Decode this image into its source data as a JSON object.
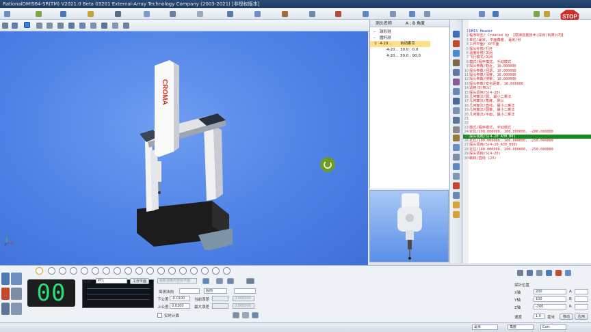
{
  "window": {
    "title": "RationalDMIS64-SR(TM) V2021.0 Beta 03201   External-Array Technology Company (2003-2021) [非授权版本]"
  },
  "probe_tree": {
    "header_col1": "测头名称",
    "header_col2": "A : B 角度",
    "items": [
      {
        "label": "球形测",
        "indent": 1
      },
      {
        "label": "圆杆测",
        "indent": 1
      },
      {
        "label": "4-20...",
        "value": "自动索引",
        "indent": 2,
        "selected": true
      },
      {
        "label": "4-20...",
        "value": "30.0 : 0.0",
        "indent": 3
      },
      {
        "label": "4-20...",
        "value": "30.0 : 90.0",
        "indent": 3
      }
    ]
  },
  "code_editor": {
    "lines": [
      {
        "n": "",
        "text": "DMIS  Header",
        "style": "blue"
      },
      {
        "n": "",
        "text": "程序标志/ Created by 【思姆测量技术(深圳)有限公司】",
        "style": "red"
      },
      {
        "n": "",
        "text": "单位/毫米, 平面角度, 毫米/秒",
        "style": "red"
      },
      {
        "n": "",
        "text": "工作平面/ XY平面",
        "style": "red"
      },
      {
        "n": "",
        "text": "探头补偿/打开",
        "style": "red"
      },
      {
        "n": "",
        "text": "温度补偿/关闭",
        "style": "red"
      },
      {
        "n": "",
        "text": "飞行模式/关闭",
        "style": "red"
      },
      {
        "n": "",
        "text": "模式/程序模式, 手动模式",
        "style": "red"
      },
      {
        "n": "",
        "text": "探头参数/趋近, 10.000000",
        "style": "red"
      },
      {
        "n": "",
        "text": "探头参数/回退, 10.000000",
        "style": "red"
      },
      {
        "n": "",
        "text": "探头参数/深度, 10.000000",
        "style": "red"
      },
      {
        "n": "",
        "text": "探头参数/搜索, 10.000000",
        "style": "red"
      },
      {
        "n": "",
        "text": "探头参数/安全距离, 10.000000",
        "style": "red"
      },
      {
        "n": "",
        "text": "调用/D(MCS)",
        "style": "red"
      },
      {
        "n": "",
        "text": "探头调用/S(4-20)",
        "style": "red"
      },
      {
        "n": "",
        "text": "几何算法/圆, 最小二乘法",
        "style": "red"
      },
      {
        "n": "",
        "text": "几何算法/角度, 默认",
        "style": "red"
      },
      {
        "n": "",
        "text": "几何算法/直线, 最小二乘法",
        "style": "red"
      },
      {
        "n": "",
        "text": "几何算法/圆锥, 最小二乘法",
        "style": "red"
      },
      {
        "n": "",
        "text": "几何算法/平面, 最小二乘法",
        "style": "red"
      },
      {
        "n": "",
        "text": "",
        "style": "red"
      },
      {
        "n": "",
        "text": "",
        "style": "red"
      },
      {
        "n": "",
        "text": "模式/程序模式, 手动模式",
        "style": "red"
      },
      {
        "n": "",
        "text": "定位/200.000000, 200.000000, -200.000000",
        "style": "red"
      },
      {
        "n": "",
        "text": "探头调用/S(4-20_A30_B0)",
        "style": "hl"
      },
      {
        "n": "",
        "text": "定位/200.000000, 100.000000, -250.000000",
        "style": "red"
      },
      {
        "n": "",
        "text": "探头调用/S(4-20_A30_B90)",
        "style": "red"
      },
      {
        "n": "",
        "text": "定位/100.000000, 100.000000, -250.000000",
        "style": "red"
      },
      {
        "n": "",
        "text": "探头调用/S(4-20)",
        "style": "red"
      },
      {
        "n": "",
        "text": "跳转/直线 (23)",
        "style": "red"
      }
    ]
  },
  "bottom": {
    "counter": "00",
    "name_label": "名称",
    "name_value": "PT1",
    "workplane_btn": "工作平面",
    "feature_dropdown": "最新测量的坐标平面",
    "probe_radius_label": "探测法向",
    "lower_tol_label": "下公差",
    "lower_tol_value": "-0.0100",
    "upper_tol_label": "上公差",
    "upper_tol_value": "0.0100",
    "cur_error_label": "当前误差",
    "max_error_label": "最大误差",
    "err1": "0.000000",
    "err2": "0.000000",
    "realtime_calc_label": "实时计算",
    "dropdown2": "段前",
    "pos_panel_title": "探针位置",
    "x_label": "X轴",
    "x_value": "200",
    "y_label": "Y轴",
    "y_value": "100",
    "z_label": "Z轴",
    "z_value": "-200",
    "a_label": "A",
    "b_label": "B",
    "r_label": "R",
    "speed_label": "速度",
    "speed_value": "1.0",
    "speed_unit": "毫米",
    "move_btn": "移动",
    "apply_btn": "应用"
  },
  "status": {
    "unit_dropdown": "毫米",
    "angle_dropdown": "角度",
    "coord_dropdown": "Cart"
  },
  "colors": {
    "viewport": "#4f82e6",
    "highlight": "#138a1e",
    "code_text": "#cc2a2a",
    "counter_digits": "#27e07b"
  }
}
